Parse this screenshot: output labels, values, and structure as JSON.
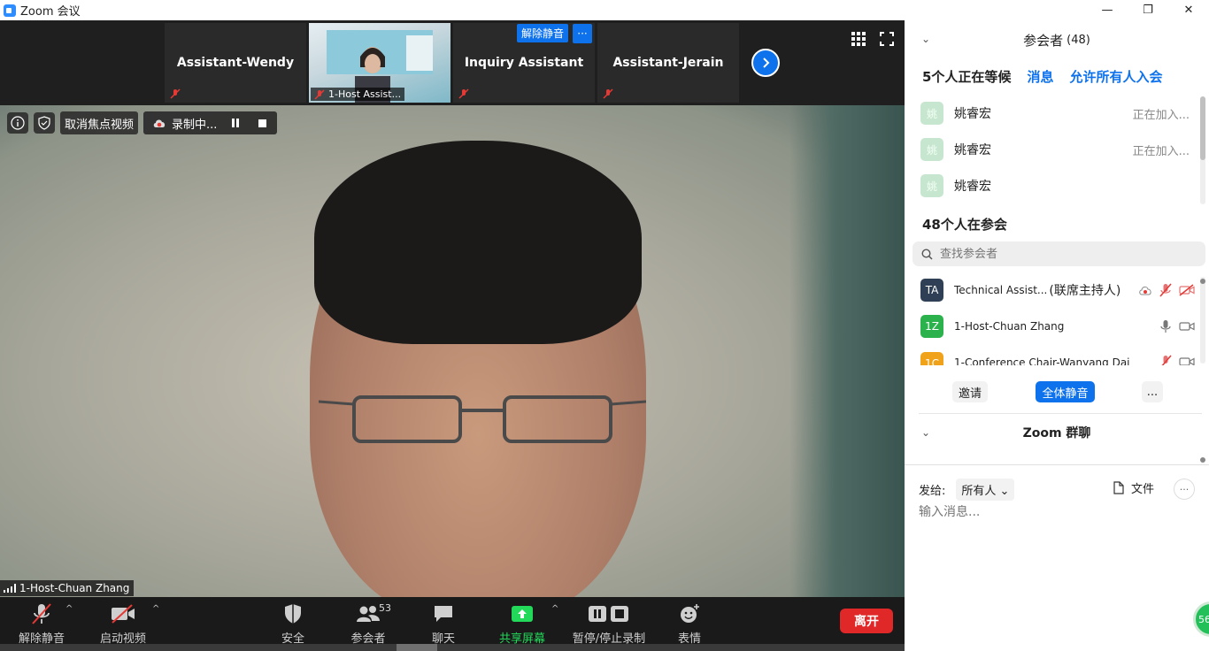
{
  "window": {
    "title": "Zoom 会议",
    "minimize": "—",
    "maximize": "❐",
    "close": "✕"
  },
  "strip": {
    "tiles": [
      {
        "name": "Assistant-Wendy"
      },
      {
        "name": "1-Host Assist..."
      },
      {
        "name": "Inquiry Assistant"
      },
      {
        "name": "Assistant-Jerain"
      }
    ],
    "unmute_popup": "解除静音",
    "more_popup": "···"
  },
  "overlay": {
    "unfocus_label": "取消焦点视频",
    "recording_label": "录制中..."
  },
  "main": {
    "speaker_name": "1-Host-Chuan Zhang"
  },
  "toolbar": {
    "unmute": "解除静音",
    "start_video": "启动视频",
    "security": "安全",
    "participants": "参会者",
    "participants_count": "53",
    "chat": "聊天",
    "share": "共享屏幕",
    "pause_record": "暂停/停止录制",
    "reactions": "表情",
    "leave": "离开"
  },
  "panel": {
    "title": "参会者",
    "count": "(48)",
    "waiting_header": "5个人正在等候",
    "message_link": "消息",
    "admit_all_link": "允许所有人入会",
    "waiting": [
      {
        "avatar": "姚",
        "name": "姚睿宏",
        "status": "正在加入..."
      },
      {
        "avatar": "姚",
        "name": "姚睿宏",
        "status": "正在加入..."
      },
      {
        "avatar": "姚",
        "name": "姚睿宏",
        "status": ""
      }
    ],
    "in_meeting_header": "48个人在参会",
    "search_placeholder": "查找参会者",
    "participants": [
      {
        "initials": "TA",
        "name": "Technical Assist...",
        "role": "(联席主持人)",
        "color": "#2f3f55"
      },
      {
        "initials": "1Z",
        "name": "1-Host-Chuan Zhang",
        "role": "",
        "color": "#2bb24c"
      },
      {
        "initials": "1C",
        "name": "1-Conference Chair-Wanyang Dai",
        "role": "",
        "color": "#f0a21a"
      }
    ],
    "invite": "邀请",
    "mute_all": "全体静音",
    "more": "...",
    "chat_title": "Zoom 群聊",
    "send_to_label": "发给:",
    "send_to_value": "所有人",
    "file_label": "文件",
    "chat_more": "···",
    "message_placeholder": "输入消息..."
  },
  "corner_badge": "56"
}
